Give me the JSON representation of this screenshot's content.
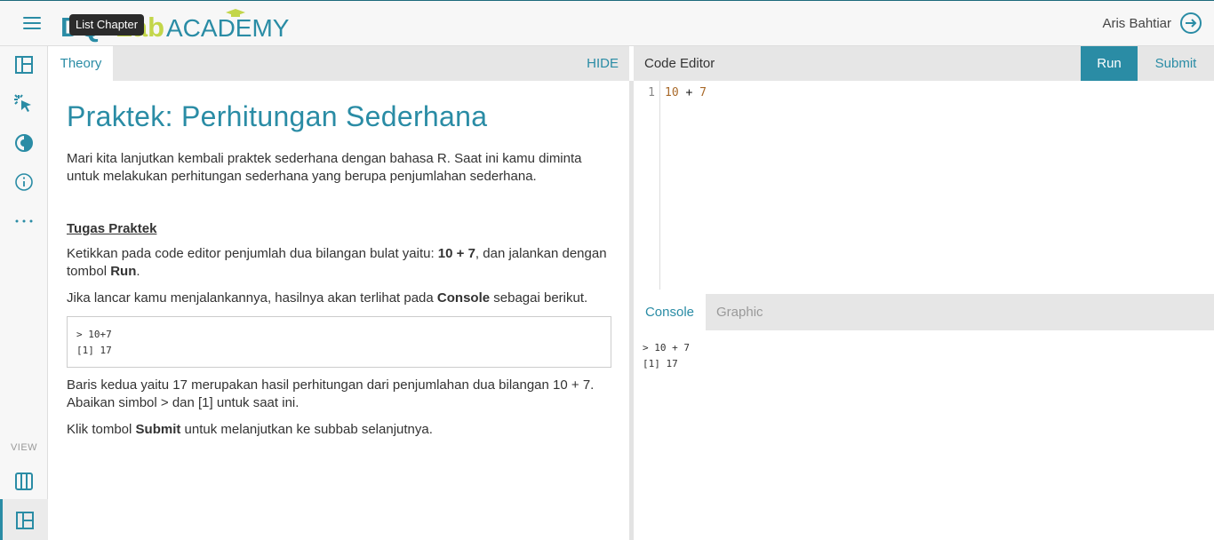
{
  "header": {
    "logo": {
      "part1": "DQ",
      "part2": "Lab",
      "part3": "ACADEMY"
    },
    "tooltip": "List Chapter",
    "username": "Aris Bahtiar"
  },
  "sidebar": {
    "view_label": "VIEW",
    "icons": [
      "layout-icon",
      "cursor-click-icon",
      "contrast-icon",
      "info-icon",
      "more-dots-icon",
      "columns-icon",
      "layout-panel-icon"
    ]
  },
  "theory": {
    "tab_label": "Theory",
    "hide_label": "HIDE",
    "title": "Praktek: Perhitungan Sederhana",
    "intro": "Mari kita lanjutkan kembali praktek sederhana dengan bahasa R. Saat ini kamu diminta untuk melakukan perhitungan sederhana yang berupa penjumlahan sederhana.",
    "task_heading": "Tugas Praktek",
    "task_p1": {
      "a": "Ketikkan pada code editor penjumlah dua bilangan bulat yaitu: ",
      "b": "10 + 7",
      "c": ", dan jalankan dengan tombol ",
      "d": "Run",
      "e": "."
    },
    "task_p2": {
      "a": "Jika lancar kamu menjalankannya, hasilnya akan terlihat pada ",
      "b": "Console",
      "c": " sebagai berikut."
    },
    "code_sample": {
      "line1": "> 10+7",
      "line2": "[1] 17"
    },
    "explain": "Baris kedua yaitu 17 merupakan hasil perhitungan dari penjumlahan dua bilangan 10 + 7. Abaikan simbol > dan [1] untuk saat ini.",
    "closing": {
      "a": "Klik tombol ",
      "b": "Submit",
      "c": " untuk melanjutkan ke subbab selanjutnya."
    }
  },
  "editor": {
    "title": "Code Editor",
    "run_label": "Run",
    "submit_label": "Submit",
    "line_number": "1",
    "code": {
      "n1": "10",
      "op": " + ",
      "n2": "7"
    }
  },
  "console": {
    "tab_console": "Console",
    "tab_graphic": "Graphic",
    "output_line1": "> 10 + 7",
    "output_line2": "[1] 17"
  },
  "colors": {
    "accent": "#2a8ca5",
    "logo_green": "#c3d64a"
  }
}
